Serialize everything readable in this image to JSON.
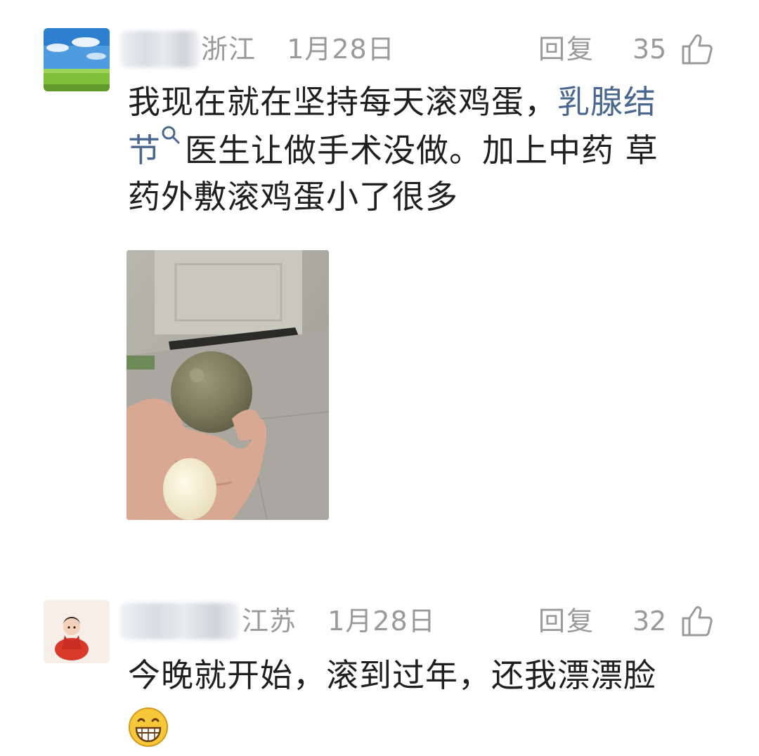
{
  "comments": [
    {
      "location": "浙江",
      "date": "1月28日",
      "reply_label": "回复",
      "likes": "35",
      "text_part1": "我现在就在坚持每天滚鸡蛋，",
      "topic_line1": "乳腺结",
      "topic_line2": "节",
      "text_part2": "医生让做手术没做。加上中药 草",
      "text_part3": "药外敷滚鸡蛋小了很多"
    },
    {
      "location": "江苏",
      "date": "1月28日",
      "reply_label": "回复",
      "likes": "32",
      "text": "今晚就开始，滚到过年，还我漂漂脸"
    }
  ],
  "colors": {
    "meta": "#9a9a9a",
    "topic_link": "#4a6790",
    "text": "#1f1f1f"
  },
  "icons": {
    "like": "thumbs-up-icon",
    "topic": "search-icon",
    "emoji": "grin-emoji-icon"
  }
}
